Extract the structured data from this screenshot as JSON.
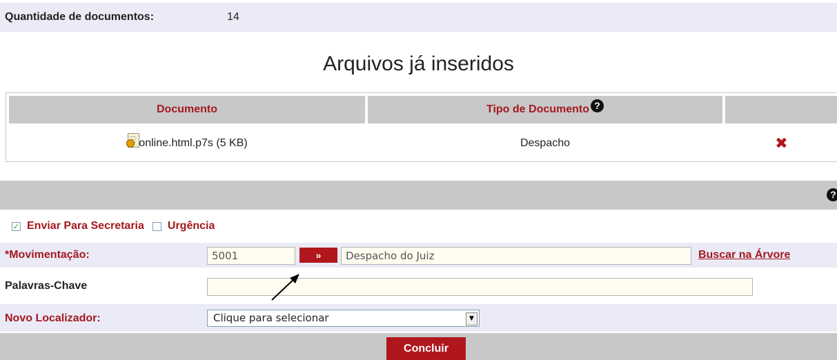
{
  "summary": {
    "label": "Quantidade de documentos:",
    "value": "14"
  },
  "heading": "Arquivos já inseridos",
  "table": {
    "headers": [
      "Documento",
      "Tipo de Documento",
      ""
    ],
    "help_glyph": "?",
    "rows": [
      {
        "file": "online.html.p7s (5 KB)",
        "type": "Despacho",
        "action_icon": "delete-icon"
      }
    ]
  },
  "section": {
    "help_glyph": "?"
  },
  "options": {
    "send_label": "Enviar Para Secretaria",
    "send_checked": true,
    "urgent_label": "Urgência",
    "urgent_checked": false,
    "check_glyph": "✓"
  },
  "movimentacao": {
    "label": "*Movimentação:",
    "code": "5001",
    "go_label": "»",
    "description": "Despacho do Juiz",
    "tree_link": "Buscar na Árvore"
  },
  "keywords": {
    "label": "Palavras-Chave",
    "value": ""
  },
  "locator": {
    "label": "Novo Localizador:",
    "selected": "Clique para selecionar",
    "arrow": "▼"
  },
  "footer": {
    "conclude_label": "Concluir"
  },
  "colors": {
    "accent": "#a3191f",
    "button": "#b0171c",
    "shade": "#ebebf7",
    "bar": "#c8c8c8"
  }
}
